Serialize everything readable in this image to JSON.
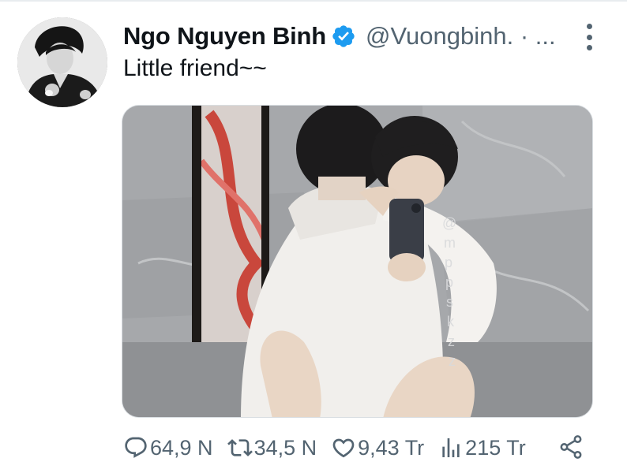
{
  "tweet": {
    "display_name": "Ngo Nguyen Binh",
    "handle": "@Vuongbinh. · ...",
    "text": "Little friend~~",
    "verified": true,
    "media_watermark": "@mppskzz"
  },
  "actions": {
    "replies": "64,9 N",
    "retweets": "34,5 N",
    "likes": "9,43 Tr",
    "views": "215 Tr"
  },
  "icons": {
    "reply": "reply-icon",
    "retweet": "retweet-icon",
    "like": "heart-icon",
    "views": "views-icon",
    "share": "share-icon",
    "more": "more-vertical-icon",
    "verified": "verified-badge-icon"
  },
  "colors": {
    "verified_blue": "#1d9bf0",
    "secondary_text": "#536471",
    "primary_text": "#0f1419"
  }
}
